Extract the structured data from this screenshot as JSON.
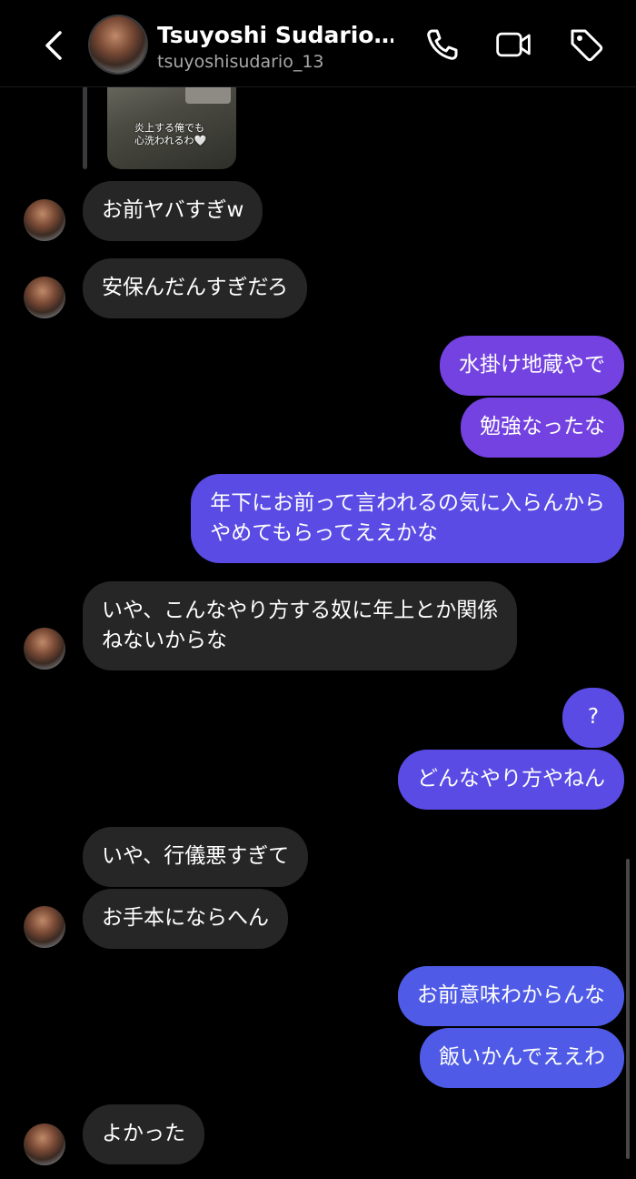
{
  "header": {
    "title": "Tsuyoshi Sudario…",
    "username": "tsuyoshisudario_13"
  },
  "shared_post": {
    "caption": "炎上する俺でも\n心洗われるわ🤍"
  },
  "messages": [
    {
      "side": "received",
      "text": "お前ヤバすぎw"
    },
    {
      "side": "received",
      "text": "安保んだんすぎだろ"
    },
    {
      "side": "sent",
      "text": "水掛け地蔵やで"
    },
    {
      "side": "sent",
      "text": "勉強なったな"
    },
    {
      "side": "sent",
      "text": "年下にお前って言われるの気に入らんから\nやめてもらってええかな"
    },
    {
      "side": "received",
      "text": "いや、こんなやり方する奴に年上とか関係\nねないからな"
    },
    {
      "side": "sent",
      "text": "?"
    },
    {
      "side": "sent",
      "text": "どんなやり方やねん"
    },
    {
      "side": "received",
      "text": "いや、行儀悪すぎて"
    },
    {
      "side": "received",
      "text": "お手本にならへん"
    },
    {
      "side": "sent",
      "text": "お前意味わからんな"
    },
    {
      "side": "sent",
      "text": "飯いかんでええわ"
    },
    {
      "side": "received",
      "text": "よかった"
    }
  ],
  "colors": {
    "background": "#000000",
    "received_bubble": "#262626",
    "sent_purple": "#7342e0",
    "sent_indigo": "#5a4be4",
    "sent_blue": "#4f5be6"
  },
  "icons": [
    "back-arrow",
    "phone",
    "video-camera",
    "tag"
  ]
}
